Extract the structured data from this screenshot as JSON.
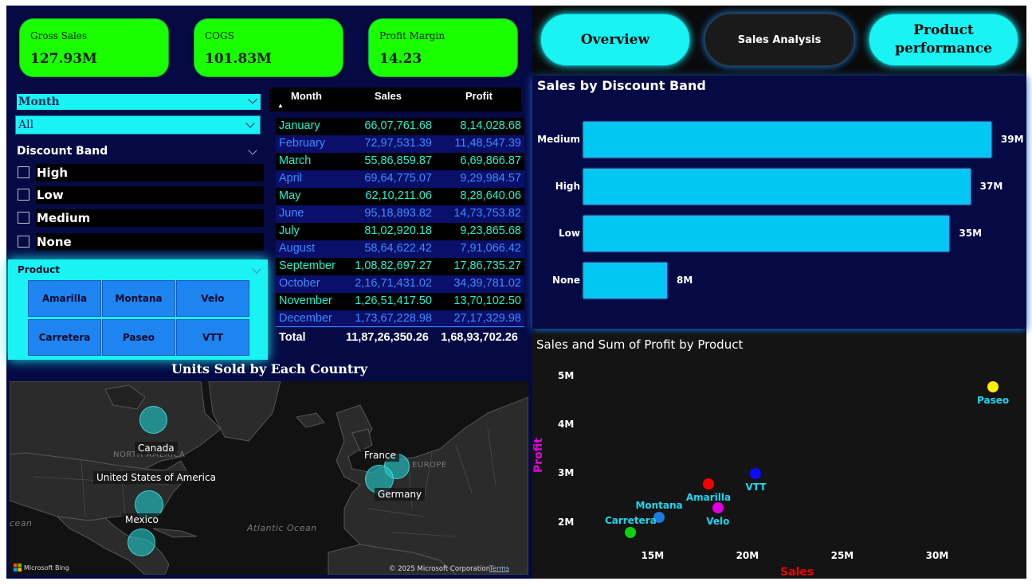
{
  "kpis": [
    {
      "label": "Gross Sales",
      "value": "127.93M"
    },
    {
      "label": "COGS",
      "value": "101.83M"
    },
    {
      "label": "Profit Margin",
      "value": "14.23"
    }
  ],
  "nav": {
    "overview": "Overview",
    "sales_analysis": "Sales Analysis",
    "product_performance_1": "Product",
    "product_performance_2": "performance"
  },
  "month_slicer": {
    "title": "Month",
    "selected": "All"
  },
  "discount_slicer": {
    "title": "Discount Band",
    "options": [
      "High",
      "Low",
      "Medium",
      "None"
    ]
  },
  "product_slicer": {
    "title": "Product",
    "options": [
      "Amarilla",
      "Montana",
      "Velo",
      "Carretera",
      "Paseo",
      "VTT"
    ]
  },
  "table": {
    "headers": [
      "Month",
      "Sales",
      "Profit"
    ],
    "rows": [
      [
        "January",
        "66,07,761.68",
        "8,14,028.68"
      ],
      [
        "February",
        "72,97,531.39",
        "11,48,547.39"
      ],
      [
        "March",
        "55,86,859.87",
        "6,69,866.87"
      ],
      [
        "April",
        "69,64,775.07",
        "9,29,984.57"
      ],
      [
        "May",
        "62,10,211.06",
        "8,28,640.06"
      ],
      [
        "June",
        "95,18,893.82",
        "14,73,753.82"
      ],
      [
        "July",
        "81,02,920.18",
        "9,23,865.68"
      ],
      [
        "August",
        "58,64,622.42",
        "7,91,066.42"
      ],
      [
        "September",
        "1,08,82,697.27",
        "17,86,735.27"
      ],
      [
        "October",
        "2,16,71,431.02",
        "34,39,781.02"
      ],
      [
        "November",
        "1,26,51,417.50",
        "13,70,102.50"
      ],
      [
        "December",
        "1,73,67,228.98",
        "27,17,329.98"
      ]
    ],
    "total": [
      "Total",
      "11,87,26,350.26",
      "1,68,93,702.26"
    ]
  },
  "map": {
    "title": "Units Sold by Each Country",
    "countries": [
      "Canada",
      "United States of America",
      "Mexico",
      "France",
      "Germany"
    ],
    "regions": [
      "NORTH AMERICA",
      "EUROPE",
      "Atlantic Ocean",
      "cean"
    ],
    "attribution": "© 2025 Microsoft Corporation",
    "terms": "Terms",
    "logo": "Microsoft Bing"
  },
  "chart_data": [
    {
      "type": "bar",
      "title": "Sales by Discount Band",
      "categories": [
        "Medium",
        "High",
        "Low",
        "None"
      ],
      "values": [
        39,
        37,
        35,
        8
      ],
      "value_labels": [
        "39M",
        "37M",
        "35M",
        "8M"
      ],
      "orientation": "horizontal",
      "xlim": [
        0,
        40
      ],
      "colors": {
        "bar": "#00c8f2"
      }
    },
    {
      "type": "scatter",
      "title": "Sales and Sum of Profit by Product",
      "xlabel": "Sales",
      "ylabel": "Profit",
      "x_ticks": [
        "15M",
        "20M",
        "25M",
        "30M"
      ],
      "y_ticks": [
        "5M",
        "4M",
        "3M",
        "2M"
      ],
      "xlim": [
        12.5,
        33.5
      ],
      "ylim": [
        1.6,
        5.3
      ],
      "points": [
        {
          "name": "Paseo",
          "x": 33,
          "y": 4.8,
          "color": "#ffee00"
        },
        {
          "name": "VTT",
          "x": 20.5,
          "y": 3.0,
          "color": "#0a0aff"
        },
        {
          "name": "Amarilla",
          "x": 18,
          "y": 2.8,
          "color": "#ff0000"
        },
        {
          "name": "Velo",
          "x": 18.5,
          "y": 2.3,
          "color": "#e000e0"
        },
        {
          "name": "Montana",
          "x": 15.4,
          "y": 2.1,
          "color": "#1e7ae0"
        },
        {
          "name": "Carretera",
          "x": 13.9,
          "y": 1.8,
          "color": "#10d010"
        }
      ]
    }
  ]
}
